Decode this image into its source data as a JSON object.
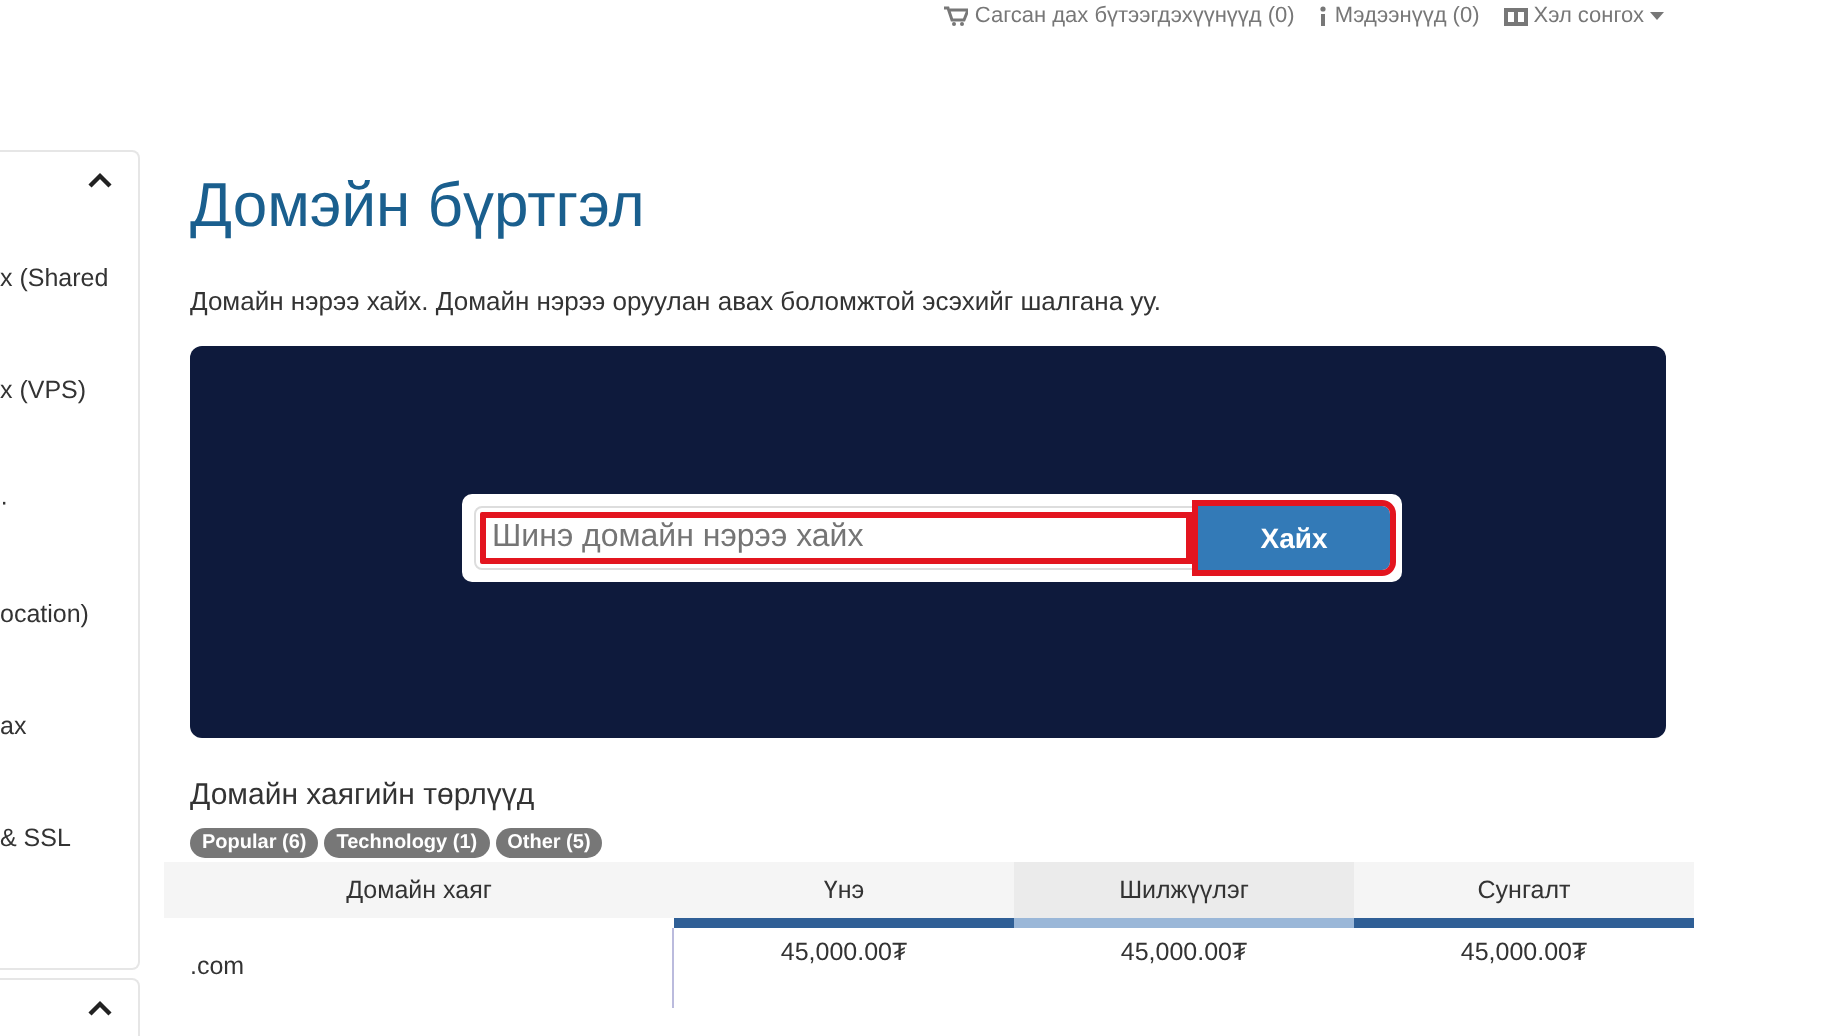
{
  "top_nav": [
    {
      "kind": "cart",
      "label": "Сагсан дах бүтээгдэхүүнүүд (0)"
    },
    {
      "kind": "info",
      "label": "Мэдээнүүд (0)"
    },
    {
      "kind": "language",
      "label": "Хэл сонгох",
      "dropdown": true
    }
  ],
  "sidebar": {
    "panels": [
      {
        "expanded": true,
        "items": [
          "x (Shared",
          "x (VPS)",
          "·",
          "ocation)",
          "ax",
          "& SSL"
        ]
      },
      {
        "expanded": true
      }
    ]
  },
  "page": {
    "title": "Домэйн бүртгэл",
    "intro": "Домайн нэрээ хайх. Домайн нэрээ оруулан авах боломжтой эсэхийг шалгана уу.",
    "search": {
      "placeholder": "Шинэ домайн нэрээ хайх",
      "highlighted": true,
      "button": {
        "label": "Хайх",
        "highlighted": true
      }
    }
  },
  "tld_section": {
    "title": "Домайн хаягийн төрлүүд",
    "tags": [
      "Popular (6)",
      "Technology (1)",
      "Other (5)"
    ],
    "table": {
      "columns": [
        {
          "label": "Домайн хаяг",
          "selected": false
        },
        {
          "label": "Үнэ",
          "selected": false
        },
        {
          "label": "Шилжүүлэг",
          "selected": true
        },
        {
          "label": "Сунгалт",
          "selected": false
        }
      ],
      "rows": [
        {
          "cells": [
            ".com",
            "45,000.00₮",
            "45,000.00₮",
            "45,000.00₮"
          ]
        }
      ]
    }
  }
}
